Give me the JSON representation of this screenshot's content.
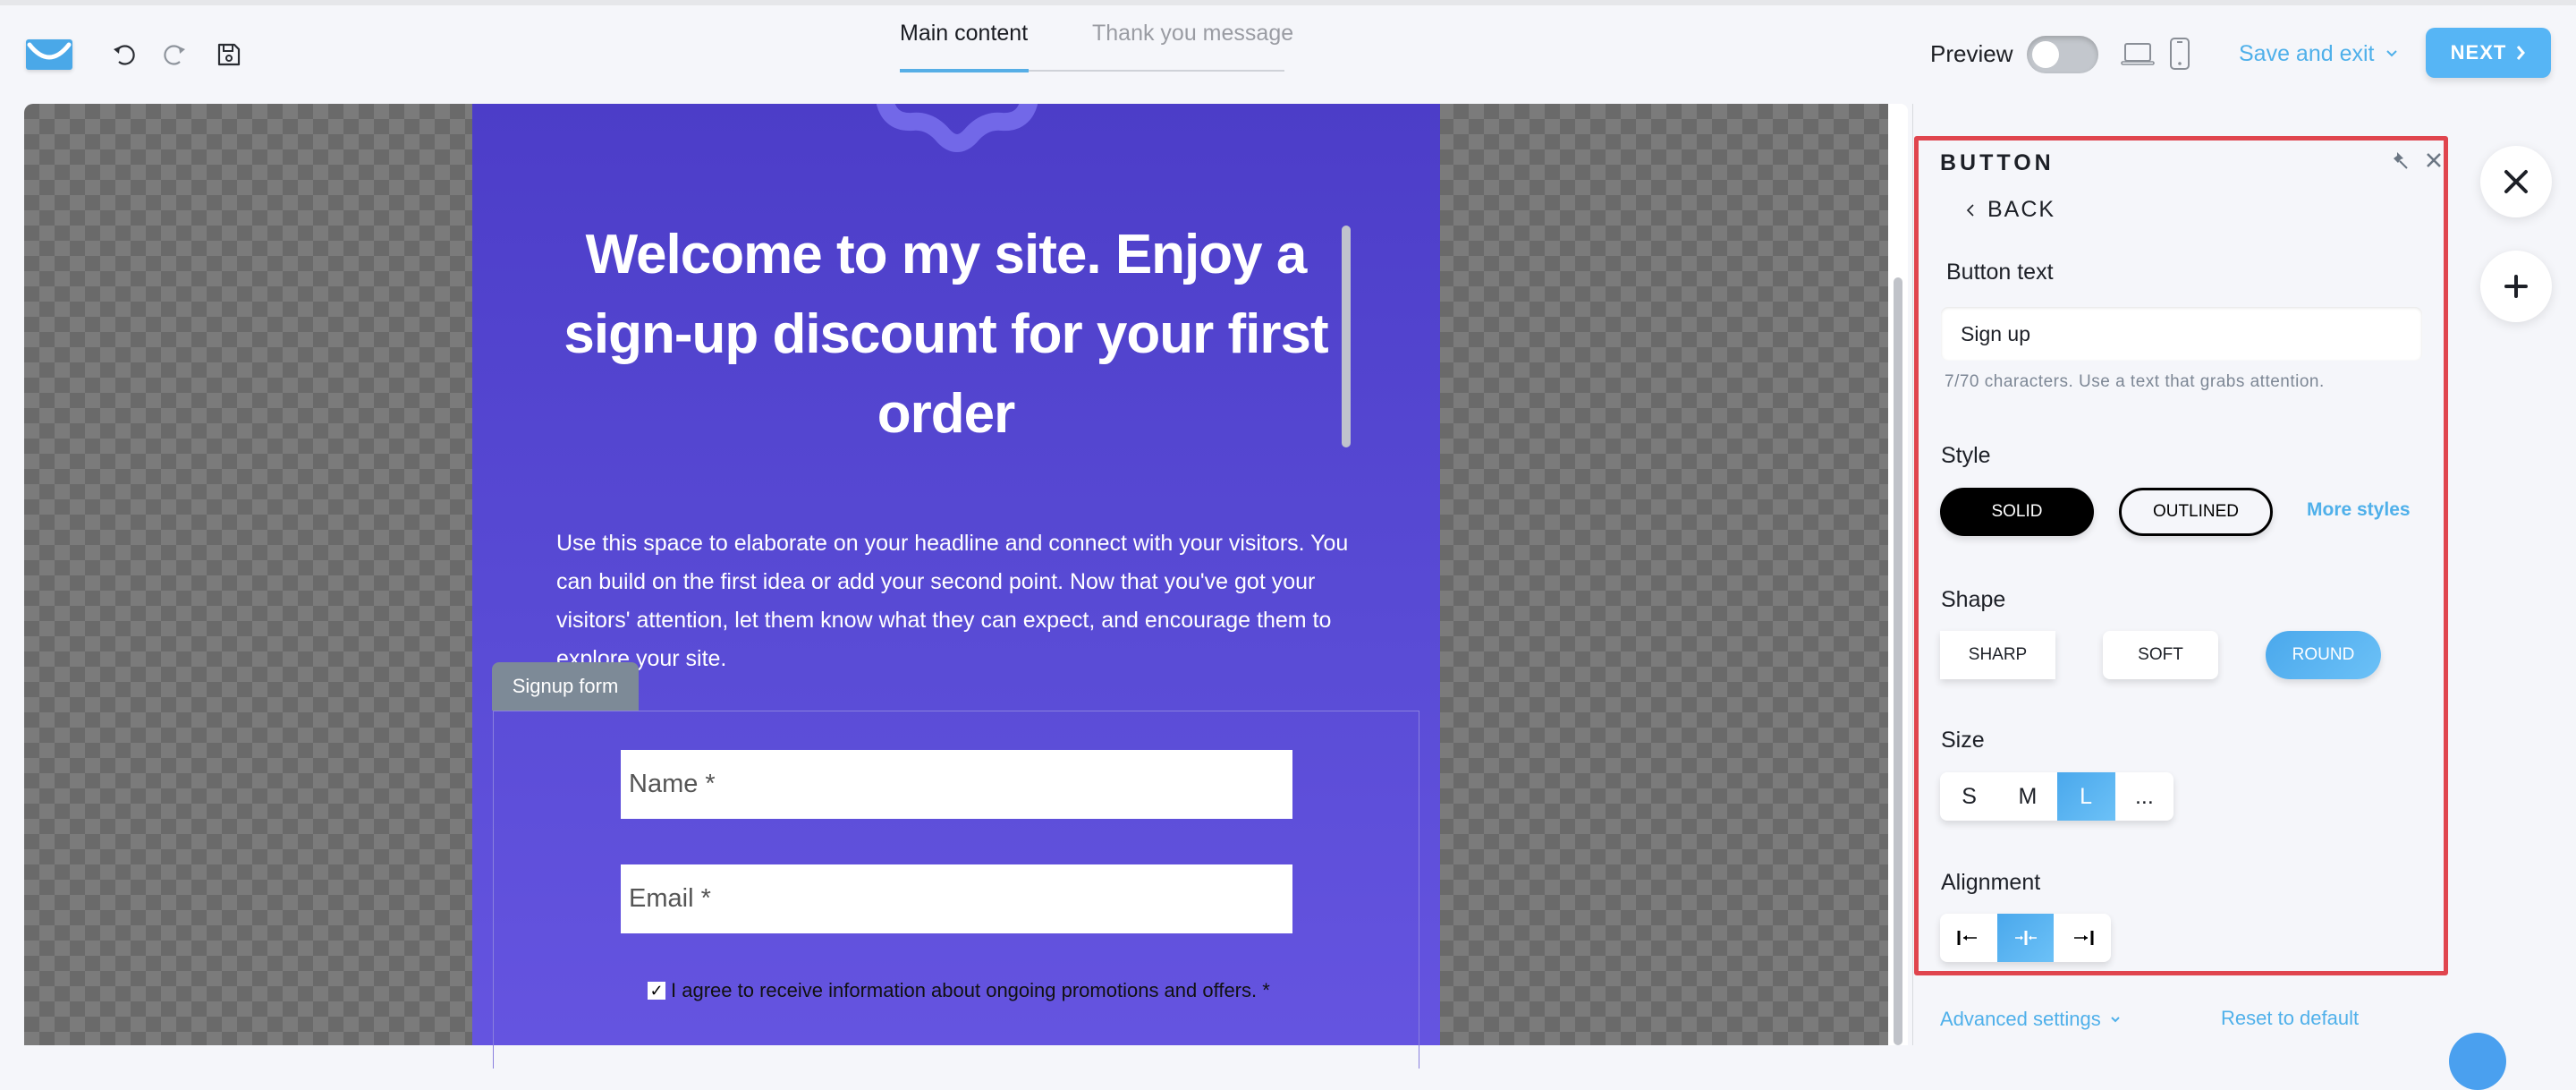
{
  "header": {
    "logo_icon": "envelope-logo-icon",
    "undo_icon": "undo-icon",
    "redo_icon": "redo-icon",
    "save_icon": "floppy-disk-icon",
    "tabs": [
      {
        "label": "Main content",
        "active": true
      },
      {
        "label": "Thank you message",
        "active": false
      }
    ],
    "preview_label": "Preview",
    "preview_enabled": false,
    "device_icons": [
      "laptop-icon",
      "smartphone-icon"
    ],
    "save_exit_label": "Save and exit",
    "next_label": "NEXT",
    "accent_color": "#56b5f5"
  },
  "canvas": {
    "headline": "Welcome to my site. Enjoy a sign-up discount for your first order",
    "body": "Use this space to elaborate on your headline and connect with your visitors. You can build on the first idea or add your second point. Now that you've got your visitors' attention, let them know what they can expect, and encourage them to explore your site.",
    "signup_tag": "Signup form",
    "form": {
      "name_placeholder": "Name *",
      "email_placeholder": "Email *",
      "consent_label": "I agree to receive information about ongoing promotions and offers. *",
      "consent_checked": true
    },
    "page_color": "#5040cc"
  },
  "panel": {
    "title": "BUTTON",
    "back_label": "BACK",
    "button_text_label": "Button text",
    "button_text_value": "Sign up",
    "button_text_help": "7/70 characters. Use a text that grabs attention.",
    "style_label": "Style",
    "style_options": [
      {
        "label": "SOLID",
        "selected": true
      },
      {
        "label": "OUTLINED",
        "selected": false
      }
    ],
    "more_styles_label": "More styles",
    "shape_label": "Shape",
    "shape_options": [
      {
        "label": "SHARP",
        "selected": false
      },
      {
        "label": "SOFT",
        "selected": false
      },
      {
        "label": "ROUND",
        "selected": true
      }
    ],
    "size_label": "Size",
    "size_options": [
      {
        "label": "S",
        "selected": false
      },
      {
        "label": "M",
        "selected": false
      },
      {
        "label": "L",
        "selected": true
      },
      {
        "label": "...",
        "selected": false
      }
    ],
    "alignment_label": "Alignment",
    "alignment_options": [
      {
        "icon": "align-left-icon",
        "selected": false
      },
      {
        "icon": "align-center-icon",
        "selected": true
      },
      {
        "icon": "align-right-icon",
        "selected": false
      }
    ],
    "advanced_label": "Advanced settings",
    "reset_label": "Reset to default",
    "highlight_color": "#e0454e"
  },
  "side_actions": {
    "design_icon": "crossed-pencils-icon",
    "add_icon": "plus-icon"
  }
}
